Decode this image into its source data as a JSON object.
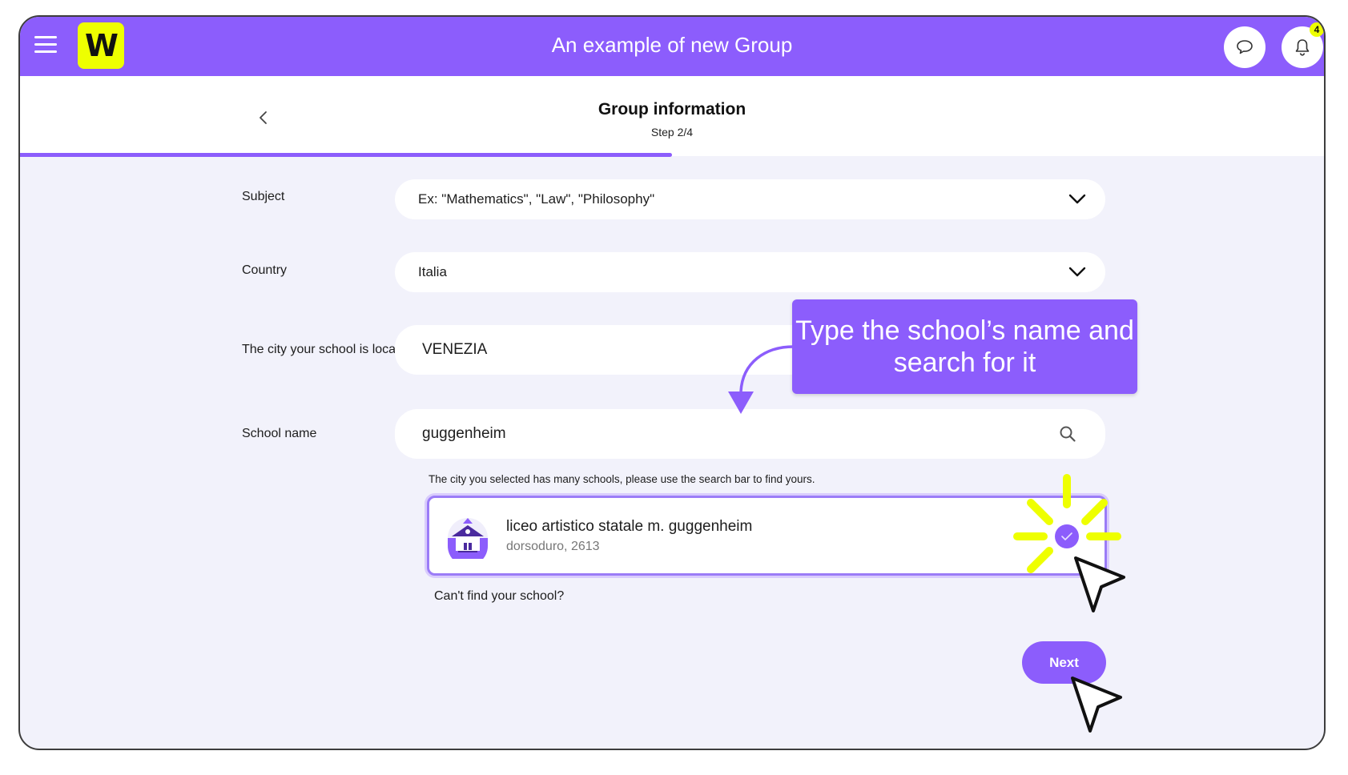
{
  "header": {
    "title": "An example of new Group",
    "logo_text": "W",
    "menu_icon": "hamburger-menu-icon",
    "chat_icon": "chat-bubble-icon",
    "notifications_icon": "bell-icon",
    "notifications_count": "4"
  },
  "step": {
    "title": "Group information",
    "subtitle": "Step 2/4",
    "current": 2,
    "total": 4,
    "progress_fraction": 0.5
  },
  "form": {
    "subject": {
      "label": "Subject",
      "placeholder": "Ex: \"Mathematics\", \"Law\", \"Philosophy\""
    },
    "country": {
      "label": "Country",
      "value": "Italia"
    },
    "city": {
      "label": "The city your school is located",
      "value": "VENEZIA"
    },
    "school": {
      "label": "School name",
      "value": "guggenheim",
      "helper": "The city you selected has many schools, please use the search bar to find yours."
    }
  },
  "result": {
    "name": "liceo artistico statale m. guggenheim",
    "address": "dorsoduro, 2613",
    "selected": true
  },
  "links": {
    "cant_find": "Can't find your school?"
  },
  "buttons": {
    "next": "Next"
  },
  "annotation": {
    "tooltip": "Type the school’s name and search for it"
  },
  "colors": {
    "brand": "#8c5dfc",
    "accent_yellow": "#eeff00",
    "background": "#f2f2fb"
  }
}
